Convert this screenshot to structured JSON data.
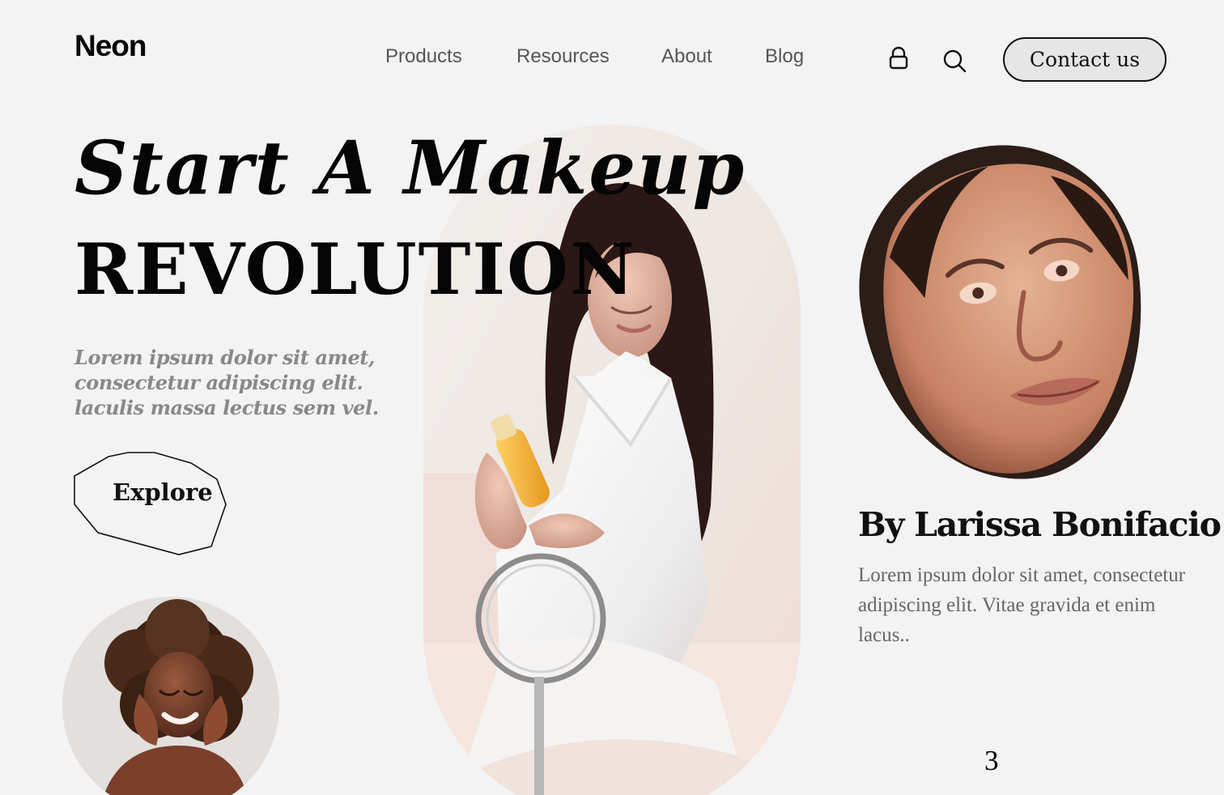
{
  "header": {
    "logo": "Neon",
    "nav": [
      {
        "label": "Products"
      },
      {
        "label": "Resources"
      },
      {
        "label": "About"
      },
      {
        "label": "Blog"
      }
    ],
    "icons": [
      "lock-icon",
      "search-icon"
    ],
    "contact_label": "Contact us"
  },
  "hero": {
    "title_line_1": "Start A  Makeup",
    "title_line_2": "REVOLUTION",
    "description": "Lorem ipsum dolor sit amet, consectetur adipiscing elit. laculis massa lectus sem vel.",
    "button_label": "Explore"
  },
  "author": {
    "name": "By Larissa Bonifacio",
    "description": "Lorem ipsum dolor sit amet, consectetur adipiscing elit. Vitae gravida et enim lacus.."
  },
  "pager": {
    "current_page": "3"
  },
  "colors": {
    "background": "#f3f3f3",
    "text": "#111111",
    "muted_text": "#888888",
    "button_fill": "#e6e6e6"
  }
}
